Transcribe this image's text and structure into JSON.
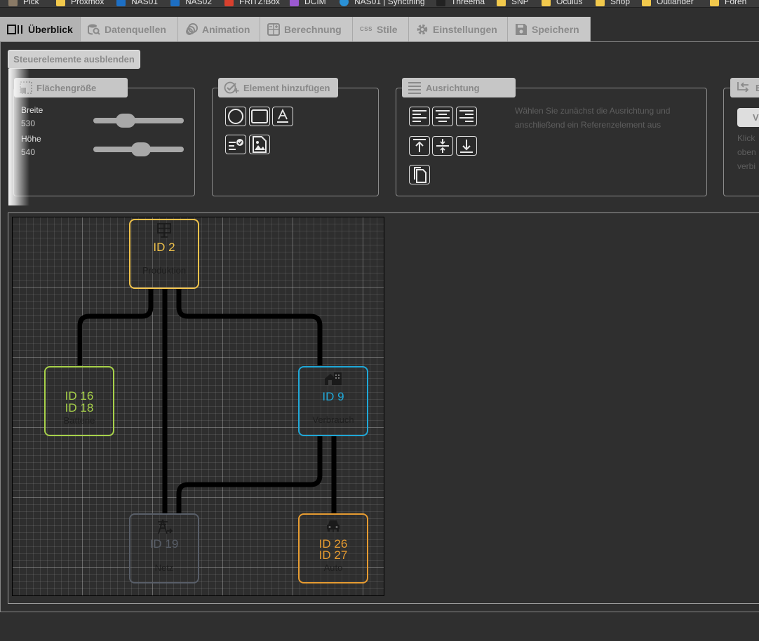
{
  "bookmarks": [
    "Pick",
    "Proxmox",
    "NAS01",
    "NAS02",
    "FRITZ!Box",
    "DCIM",
    "NAS01 | Syncthing",
    "Threema",
    "SNP",
    "Oculus",
    "Shop",
    "Outlander",
    "Foren"
  ],
  "tabs": [
    {
      "label": "Überblick",
      "icon": "overview-icon",
      "active": true
    },
    {
      "label": "Datenquellen",
      "icon": "datasource-icon"
    },
    {
      "label": "Animation",
      "icon": "animation-icon"
    },
    {
      "label": "Berechnung",
      "icon": "calculation-icon"
    },
    {
      "label": "Stile",
      "icon": "css-icon",
      "icon_text": "CSS"
    },
    {
      "label": "Einstellungen",
      "icon": "gear-icon"
    },
    {
      "label": "Speichern",
      "icon": "save-icon"
    }
  ],
  "controls": {
    "hide_label": "Steuerelemente ausblenden",
    "area_size": {
      "legend": "Flächengröße",
      "width_label": "Breite",
      "width_value": "530",
      "height_label": "Höhe",
      "height_value": "540",
      "width_slider_position": 0.32,
      "height_slider_position": 0.53
    },
    "add_element": {
      "legend": "Element hinzufügen"
    },
    "alignment": {
      "legend": "Ausrichtung",
      "hint": "Wählen Sie zunächst die Ausrichtung und anschließend ein Referenzelement aus"
    },
    "connections": {
      "legend": "E",
      "button": "V",
      "hint_lines": [
        "Klick",
        "oben",
        "verbi"
      ]
    }
  },
  "colors": {
    "produktion": "#f0c24b",
    "batterie": "#a8d24a",
    "verbrauch": "#1fa8d8",
    "netz": "#585e68",
    "auto": "#e69b31"
  },
  "nodes": {
    "produktion": {
      "ids": [
        "ID 2"
      ],
      "name": "Produktion",
      "icon": "solar-panel-icon"
    },
    "batterie": {
      "ids": [
        "ID 16",
        "ID 18"
      ],
      "name": "Batterie",
      "icon": ""
    },
    "verbrauch": {
      "ids": [
        "ID 9"
      ],
      "name": "Verbrauch",
      "icon": "house-icon"
    },
    "netz": {
      "ids": [
        "ID 19"
      ],
      "name": "Netz",
      "icon": "power-grid-icon"
    },
    "auto": {
      "ids": [
        "ID 26",
        "ID 27"
      ],
      "name": "Auto",
      "icon": "car-icon"
    }
  }
}
